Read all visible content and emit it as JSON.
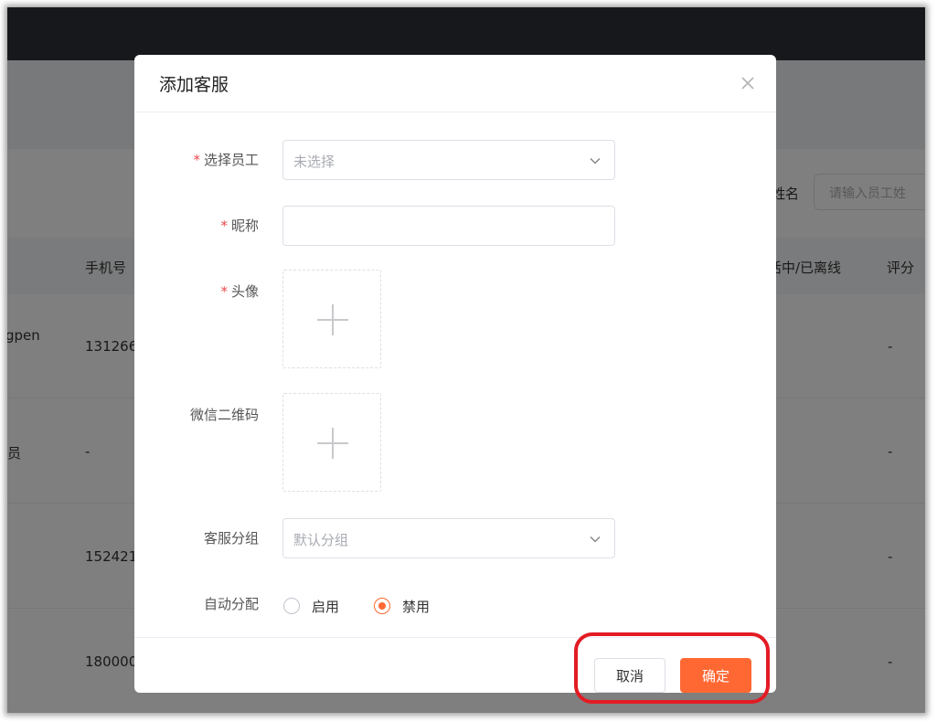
{
  "background": {
    "filter": {
      "label_fragment": "姓名",
      "placeholder_fragment": "请输入员工姓"
    },
    "table": {
      "headers": [
        "手机号",
        "活中/已离线",
        "评分"
      ],
      "rows": [
        {
          "name_fragment": "gpen",
          "phone_fragment": "131266",
          "score": "-"
        },
        {
          "name_fragment": "员",
          "phone_fragment": "-",
          "score": "-"
        },
        {
          "name_fragment": "",
          "phone_fragment": "152421",
          "score": "-"
        },
        {
          "name_fragment": "",
          "phone_fragment": "180000",
          "score": "-"
        }
      ]
    }
  },
  "modal": {
    "title": "添加客服",
    "required_mark": "*",
    "fields": {
      "employee": {
        "label": "选择员工",
        "placeholder": "未选择"
      },
      "nickname": {
        "label": "昵称",
        "value": ""
      },
      "avatar": {
        "label": "头像"
      },
      "wechat_qr": {
        "label": "微信二维码"
      },
      "group": {
        "label": "客服分组",
        "value": "默认分组"
      },
      "auto_assign": {
        "label": "自动分配",
        "options": [
          "启用",
          "禁用"
        ],
        "selected": "禁用"
      }
    },
    "buttons": {
      "cancel": "取消",
      "confirm": "确定"
    }
  },
  "colors": {
    "accent": "#ff6833",
    "required": "#e8484c",
    "highlight": "#e31b23",
    "topbar": "#2d3038"
  },
  "icons": {
    "close": "close-icon",
    "chevron": "chevron-down-icon",
    "plus": "plus-icon"
  }
}
